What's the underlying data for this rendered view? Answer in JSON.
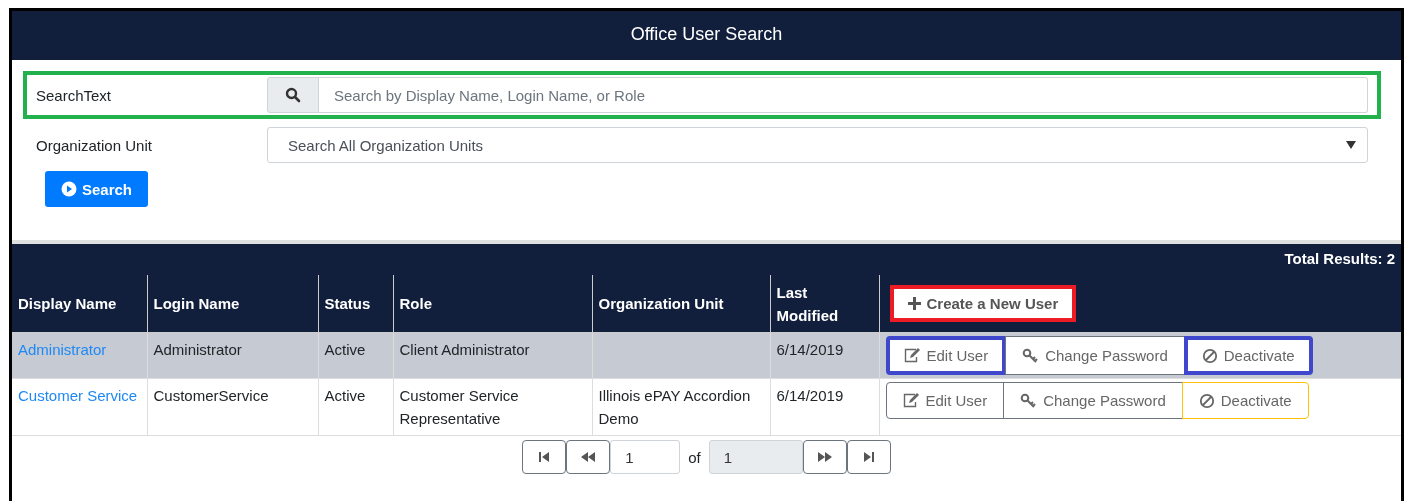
{
  "panel": {
    "title": "Office User Search"
  },
  "form": {
    "search_label": "SearchText",
    "search_placeholder": "Search by Display Name, Login Name, or Role",
    "search_frame": {
      "color": "#22b14c"
    },
    "org_label": "Organization Unit",
    "org_value": "Search All Organization Units",
    "search_button": "Search"
  },
  "results": {
    "total": "Total Results: 2",
    "columns": [
      "Display Name",
      "Login Name",
      "Status",
      "Role",
      "Organization Unit",
      "Last Modified"
    ],
    "create_button": {
      "label": "Create a New User",
      "color": "#ed1c24"
    },
    "rows": [
      {
        "selected": true,
        "display_name": "Administrator",
        "login_name": "Administrator",
        "status": "Active",
        "role": "Client Administrator",
        "org_unit": "",
        "last_modified": "6/14/2019",
        "actions": [
          {
            "kind": "edit",
            "label": "Edit User",
            "color": "#3f48cc"
          },
          {
            "kind": "password",
            "label": "Change Password"
          },
          {
            "kind": "deactivate",
            "label": "Deactivate",
            "color": "#3f48cc"
          }
        ]
      },
      {
        "selected": false,
        "display_name": "Customer Service",
        "login_name": "CustomerService",
        "status": "Active",
        "role": "Customer Service Representative",
        "org_unit": "Illinois ePAY Accordion Demo",
        "last_modified": "6/14/2019",
        "actions": [
          {
            "kind": "edit",
            "label": "Edit User"
          },
          {
            "kind": "password",
            "label": "Change Password"
          },
          {
            "kind": "deactivate",
            "label": "Deactivate"
          }
        ]
      }
    ]
  },
  "pager": {
    "page": "1",
    "of": "of",
    "pages": "1"
  }
}
